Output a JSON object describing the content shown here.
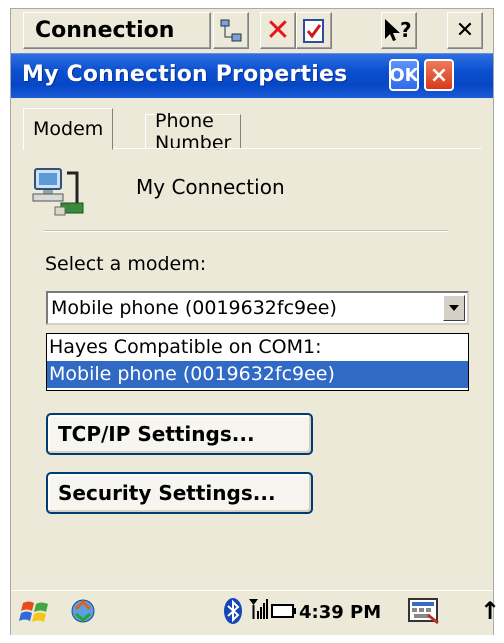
{
  "menu": {
    "label": "Connection"
  },
  "dialog": {
    "title": "My Connection Properties",
    "ok_label": "OK",
    "close_label": "×"
  },
  "tabs": [
    {
      "label": "Modem",
      "active": true
    },
    {
      "label": "Phone Number",
      "active": false
    }
  ],
  "connection_name": "My Connection",
  "modem": {
    "label": "Select a modem:",
    "selected": "Mobile phone (0019632fc9ee)",
    "options": [
      "Hayes Compatible on COM1:",
      "Mobile phone (0019632fc9ee)"
    ],
    "highlighted_index": 1
  },
  "buttons": {
    "tcpip": "TCP/IP Settings...",
    "security": "Security Settings..."
  },
  "taskbar": {
    "time": "4:39 PM"
  },
  "colors": {
    "title_bar": "#0a4fd0",
    "selection": "#316ac5",
    "close_red": "#e8141b"
  }
}
